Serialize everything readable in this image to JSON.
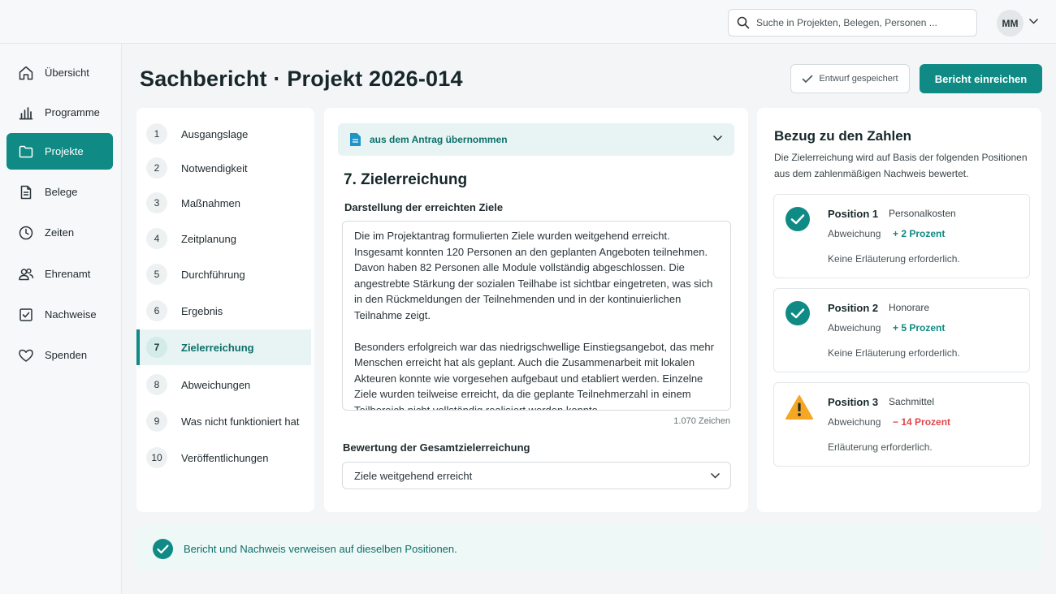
{
  "search": {
    "placeholder": "Suche in Projekten, Belegen, Personen ..."
  },
  "user": {
    "initials": "MM"
  },
  "sidebar": {
    "items": [
      {
        "label": "Übersicht",
        "icon": "home-icon"
      },
      {
        "label": "Programme",
        "icon": "bar-chart-icon"
      },
      {
        "label": "Projekte",
        "icon": "folder-icon",
        "active": true
      },
      {
        "label": "Belege",
        "icon": "document-icon"
      },
      {
        "label": "Zeiten",
        "icon": "clock-icon"
      },
      {
        "label": "Ehrenamt",
        "icon": "users-icon"
      },
      {
        "label": "Nachweise",
        "icon": "checkbox-icon"
      },
      {
        "label": "Spenden",
        "icon": "heart-icon"
      }
    ]
  },
  "header": {
    "title": "Sachbericht · Projekt 2026-014",
    "draft_label": "Entwurf gespeichert",
    "submit_label": "Bericht einreichen"
  },
  "steps": [
    {
      "num": "1",
      "label": "Ausgangslage"
    },
    {
      "num": "2",
      "label": "Notwendigkeit"
    },
    {
      "num": "3",
      "label": "Maßnahmen"
    },
    {
      "num": "4",
      "label": "Zeitplanung"
    },
    {
      "num": "5",
      "label": "Durchführung"
    },
    {
      "num": "6",
      "label": "Ergebnis"
    },
    {
      "num": "7",
      "label": "Zielerreichung",
      "active": true
    },
    {
      "num": "8",
      "label": "Abweichungen"
    },
    {
      "num": "9",
      "label": "Was nicht funktioniert hat"
    },
    {
      "num": "10",
      "label": "Veröffentlichungen"
    }
  ],
  "main": {
    "banner": "aus dem Antrag übernommen",
    "section_title": "7. Zielerreichung",
    "text_label": "Darstellung der erreichten Ziele",
    "text_p1": "Die im Projektantrag formulierten Ziele wurden weitgehend erreicht. Insgesamt konnten 120 Personen an den geplanten Angeboten teilnehmen. Davon haben 82 Personen alle Module vollständig abgeschlossen. Die angestrebte Stärkung der sozialen Teilhabe ist sichtbar eingetreten, was sich in den Rückmeldungen der Teilnehmenden und in der kontinuierlichen Teilnahme zeigt.",
    "text_p2": "Besonders erfolgreich war das niedrigschwellige Einstiegsangebot, das mehr Menschen erreicht hat als geplant. Auch die Zusammenarbeit mit lokalen Akteuren konnte wie vorgesehen aufgebaut und etabliert werden. Einzelne Ziele wurden teilweise erreicht, da die geplante Teilnehmerzahl in einem Teilbereich nicht vollständig realisiert werden konnte.",
    "char_count": "1.070 Zeichen",
    "rating_label": "Bewertung der Gesamtzielerreichung",
    "rating_value": "Ziele weitgehend erreicht"
  },
  "right": {
    "title": "Bezug zu den Zahlen",
    "description": "Die Zielerreichung wird auf Basis der folgenden Positionen aus dem zahlenmäßigen Nachweis bewertet.",
    "positions": [
      {
        "name": "Position 1",
        "type": "Personalkosten",
        "dev_label": "Abweichung",
        "deviation": "+ 2 Prozent",
        "note": "Keine Erläuterung erforderlich.",
        "status": "ok"
      },
      {
        "name": "Position 2",
        "type": "Honorare",
        "dev_label": "Abweichung",
        "deviation": "+ 5 Prozent",
        "note": "Keine Erläuterung erforderlich.",
        "status": "ok"
      },
      {
        "name": "Position 3",
        "type": "Sachmittel",
        "dev_label": "Abweichung",
        "deviation": "− 14 Prozent",
        "note": "Erläuterung erforderlich.",
        "status": "warning"
      }
    ]
  },
  "footer": {
    "message": "Bericht und Nachweis verweisen auf dieselben Positionen."
  },
  "colors": {
    "accent": "#0f8a84",
    "warning": "#f5a623",
    "negative": "#e0464c"
  }
}
